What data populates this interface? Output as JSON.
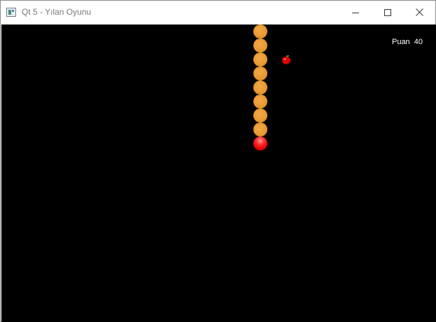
{
  "window": {
    "title": "Qt 5 - Yılan Oyunu",
    "icon": "app-window-icon",
    "controls": [
      "minimize-icon",
      "maximize-icon",
      "close-icon"
    ]
  },
  "game": {
    "background": "#000000",
    "score_label": "Puan",
    "score_value": "40",
    "snake": {
      "body_color": "#e8982f",
      "head_color": "#ff0000",
      "direction": "down",
      "body_segments": 8
    },
    "apple": {
      "icon": "apple-icon",
      "color": "#e00000"
    }
  }
}
